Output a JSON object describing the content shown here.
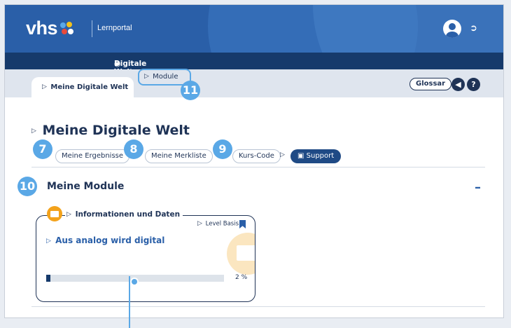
{
  "header": {
    "logo_text": "vhs",
    "portal_label": "Lernportal",
    "logo_colors": [
      "#f3c21b",
      "#5aa8e6",
      "#e94b3c",
      "#ffffff"
    ]
  },
  "breadcrumb": {
    "label": "Digitale Welt"
  },
  "tabs": {
    "active_label": "Meine Digitale Welt",
    "module_label": "Module",
    "glossar_label": "Glossar"
  },
  "page": {
    "title": "Meine Digitale Welt",
    "buttons": {
      "ergebnisse": "Meine Ergebnisse",
      "merkliste": "Meine Merkliste",
      "kurs_code": "Kurs-Code",
      "support": "Support"
    }
  },
  "section": {
    "title": "Meine Module",
    "collapse_symbol": "–"
  },
  "module_card": {
    "category": "Informationen und Daten",
    "level": "Level Basis",
    "title": "Aus analog wird digital",
    "progress_percent": 2,
    "progress_label": "2 %"
  },
  "annotations": {
    "b7": "7",
    "b8": "8",
    "b9": "9",
    "b10": "10",
    "b11": "11"
  },
  "colors": {
    "header_blue": "#2a5fa8",
    "dark_navy": "#163a6b",
    "annotation_blue": "#5aa8e6",
    "accent_orange": "#f3a21b"
  }
}
